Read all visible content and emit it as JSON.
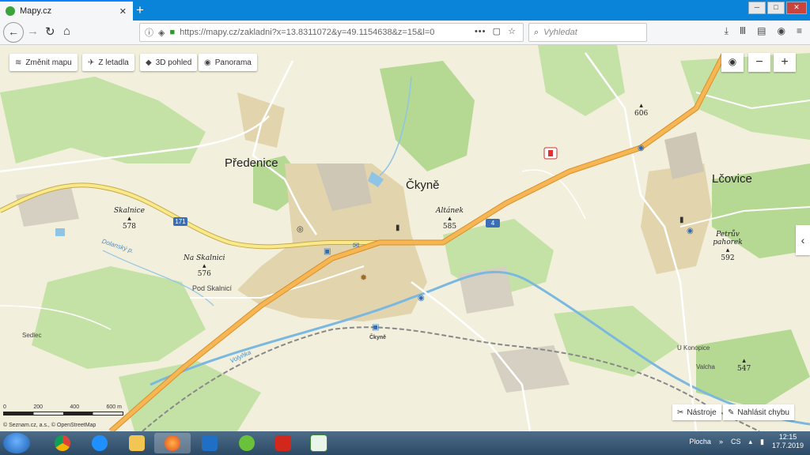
{
  "browser": {
    "tab_title": "Mapy.cz",
    "tab_close": "✕",
    "new_tab": "+",
    "url": "https://mapy.cz/zakladni?x=13.8311072&y=49.1154638&z=15&l=0",
    "url_more": "•••",
    "search_placeholder": "Vyhledat"
  },
  "map_toolbar": {
    "change_map": "Změnit mapu",
    "from_plane": "Z letadla",
    "view_3d": "3D pohled",
    "panorama": "Panorama"
  },
  "zoom": {
    "locate": "◉",
    "minus": "−",
    "plus": "+"
  },
  "places": {
    "predenice": "Předenice",
    "ckyne": "Čkyně",
    "lcovice": "Lčovice",
    "pod_skalnici": "Pod Skalnicí",
    "sedlec": "Sedlec",
    "u_konopice": "U Konopice",
    "valcha": "Valcha",
    "ckyne_station": "Čkyně",
    "dolansky": "Dolanský p.",
    "volynka": "Volyňka"
  },
  "peaks": [
    {
      "name": "Skalnice",
      "elevation": "578"
    },
    {
      "name": "Na Skalnici",
      "elevation": "576"
    },
    {
      "name": "Altánek",
      "elevation": "585"
    },
    {
      "name": "Petrův pahorek",
      "elevation": "592"
    },
    {
      "name": "",
      "elevation": "606"
    },
    {
      "name": "",
      "elevation": "547"
    }
  ],
  "roads": {
    "r171": "171",
    "r4": "4"
  },
  "bottom_tools": {
    "tools": "Nástroje",
    "report": "Nahlásit chybu"
  },
  "scale": {
    "labels": [
      "0",
      "200",
      "400",
      "600 m"
    ]
  },
  "copyright": "© Seznam.cz, a.s., © OpenStreetMap",
  "taskbar": {
    "desktop": "Plocha",
    "lang": "CS",
    "time": "12:15",
    "date": "17.7.2019"
  },
  "colors": {
    "accent": "#0a84d8",
    "road_major": "#f2b54a",
    "river": "#7ab8e0",
    "forest": "#b9dc9a",
    "built": "#dccda3"
  }
}
